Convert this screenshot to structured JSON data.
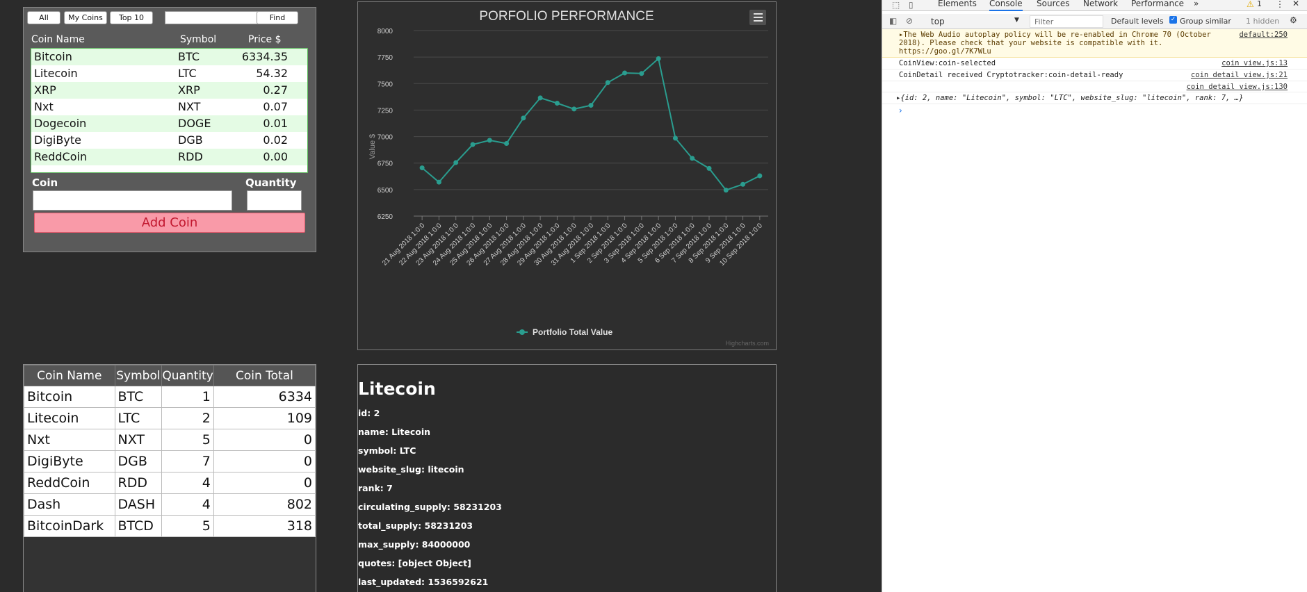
{
  "picker": {
    "buttons": [
      "All",
      "My Coins",
      "Top 10"
    ],
    "find_label": "Find",
    "search_value": "",
    "headers": {
      "name": "Coin Name",
      "symbol": "Symbol",
      "price": "Price $"
    },
    "coins": [
      {
        "name": "Bitcoin",
        "symbol": "BTC",
        "price": "6334.35"
      },
      {
        "name": "Litecoin",
        "symbol": "LTC",
        "price": "54.32"
      },
      {
        "name": "XRP",
        "symbol": "XRP",
        "price": "0.27"
      },
      {
        "name": "Nxt",
        "symbol": "NXT",
        "price": "0.07"
      },
      {
        "name": "Dogecoin",
        "symbol": "DOGE",
        "price": "0.01"
      },
      {
        "name": "DigiByte",
        "symbol": "DGB",
        "price": "0.02"
      },
      {
        "name": "ReddCoin",
        "symbol": "RDD",
        "price": "0.00"
      }
    ],
    "coin_label": "Coin",
    "quantity_label": "Quantity",
    "coin_value": "",
    "quantity_value": "",
    "add_label": "Add Coin"
  },
  "chart_data": {
    "type": "line",
    "title": "PORFOLIO PERFORMANCE",
    "ylabel": "Value $",
    "xlabel": "",
    "ylim": [
      6250,
      8000
    ],
    "yticks": [
      6250,
      6500,
      6750,
      7000,
      7250,
      7500,
      7750,
      8000
    ],
    "categories": [
      "21 Aug 2018 1:0:0",
      "22 Aug 2018 1:0:0",
      "23 Aug 2018 1:0:0",
      "24 Aug 2018 1:0:0",
      "25 Aug 2018 1:0:0",
      "26 Aug 2018 1:0:0",
      "27 Aug 2018 1:0:0",
      "28 Aug 2018 1:0:0",
      "29 Aug 2018 1:0:0",
      "30 Aug 2018 1:0:0",
      "31 Aug 2018 1:0:0",
      "1 Sep 2018 1:0:0",
      "2 Sep 2018 1:0:0",
      "3 Sep 2018 1:0:0",
      "4 Sep 2018 1:0:0",
      "5 Sep 2018 1:0:0",
      "6 Sep 2018 1:0:0",
      "7 Sep 2018 1:0:0",
      "8 Sep 2018 1:0:0",
      "9 Sep 2018 1:0:0",
      "10 Sep 2018 1:0:0"
    ],
    "series": [
      {
        "name": "Portfolio Total Value",
        "color": "#2a9d8f",
        "values": [
          6705,
          6570,
          6755,
          6925,
          6965,
          6935,
          7175,
          7365,
          7315,
          7260,
          7295,
          7510,
          7600,
          7595,
          7735,
          6985,
          6795,
          6700,
          6495,
          6550,
          6630
        ]
      }
    ],
    "legend": "bottom-center",
    "credits": "Highcharts.com",
    "grid": true
  },
  "portfolio": {
    "headers": [
      "Coin Name",
      "Symbol",
      "Quantity",
      "Coin Total"
    ],
    "rows": [
      [
        "Bitcoin",
        "BTC",
        "1",
        "6334"
      ],
      [
        "Litecoin",
        "LTC",
        "2",
        "109"
      ],
      [
        "Nxt",
        "NXT",
        "5",
        "0"
      ],
      [
        "DigiByte",
        "DGB",
        "7",
        "0"
      ],
      [
        "ReddCoin",
        "RDD",
        "4",
        "0"
      ],
      [
        "Dash",
        "DASH",
        "4",
        "802"
      ],
      [
        "BitcoinDark",
        "BTCD",
        "5",
        "318"
      ]
    ]
  },
  "detail": {
    "title": "Litecoin",
    "lines": [
      "id: 2",
      "name: Litecoin",
      "symbol: LTC",
      "website_slug: litecoin",
      "rank: 7",
      "circulating_supply: 58231203",
      "total_supply: 58231203",
      "max_supply: 84000000",
      "quotes: [object Object]",
      "last_updated: 1536592621"
    ]
  },
  "devtools": {
    "tabs": [
      "Elements",
      "Console",
      "Sources",
      "Network",
      "Performance"
    ],
    "more": "»",
    "warning_count": "1",
    "context": "top",
    "filter_placeholder": "Filter",
    "levels": "Default levels",
    "group_similar": "Group similar",
    "hidden": "1 hidden",
    "messages": [
      {
        "text": "▸The Web Audio autoplay policy will be re-enabled in Chrome 70 (October 2018). Please check that your website is compatible with it. https://goo.gl/7K7WLu",
        "src": "default:250",
        "warn": true
      },
      {
        "text": "CoinView:coin-selected",
        "src": "coin view.js:13",
        "warn": false
      },
      {
        "text": "CoinDetail received Cryptotracker:coin-detail-ready",
        "src": "coin detail view.js:21",
        "warn": false
      },
      {
        "text": "",
        "src": "coin detail view.js:130",
        "warn": false
      },
      {
        "text": "▸{id: 2, name: \"Litecoin\", symbol: \"LTC\", website_slug: \"litecoin\", rank: 7, …}",
        "src": "",
        "warn": false
      }
    ],
    "prompt": "›"
  }
}
